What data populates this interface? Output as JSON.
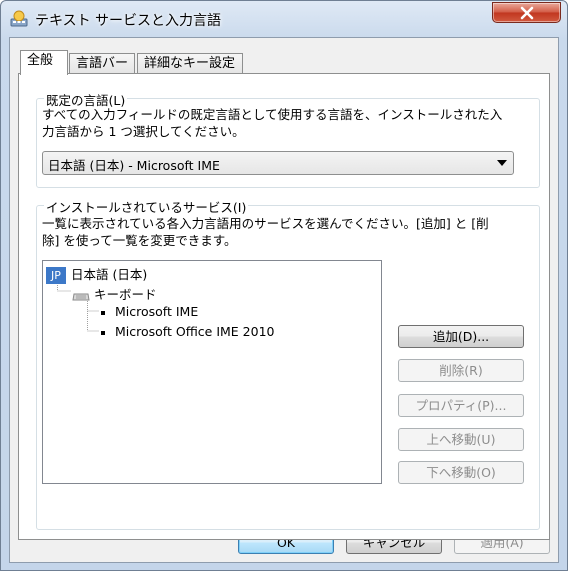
{
  "window": {
    "title": "テキスト サービスと入力言語",
    "close_icon": "close-x-icon"
  },
  "tabs": [
    {
      "label": "全般",
      "active": true
    },
    {
      "label": "言語バー",
      "active": false
    },
    {
      "label": "詳細なキー設定",
      "active": false
    }
  ],
  "default_language": {
    "group_label": "既定の言語(L)",
    "description_line1": "すべての入力フィールドの既定言語として使用する言語を、インストールされた入",
    "description_line2": "力言語から 1 つ選択してください。",
    "selected_value": "日本語 (日本) - Microsoft IME"
  },
  "installed_services": {
    "group_label": "インストールされているサービス(I)",
    "description_line1": "一覧に表示されている各入力言語用のサービスを選んでください。[追加] と [削",
    "description_line2": "除] を使って一覧を変更できます。",
    "tree": {
      "language_badge": "JP",
      "language": "日本語 (日本)",
      "category": "キーボード",
      "services": [
        "Microsoft IME",
        "Microsoft Office IME 2010"
      ]
    },
    "buttons": {
      "add": "追加(D)...",
      "remove": "削除(R)",
      "properties": "プロパティ(P)...",
      "move_up": "上へ移動(U)",
      "move_down": "下へ移動(O)"
    }
  },
  "footer": {
    "ok": "OK",
    "cancel": "キャンセル",
    "apply": "適用(A)"
  },
  "colors": {
    "accent": "#3c78c8",
    "close_button": "#c0361f"
  }
}
